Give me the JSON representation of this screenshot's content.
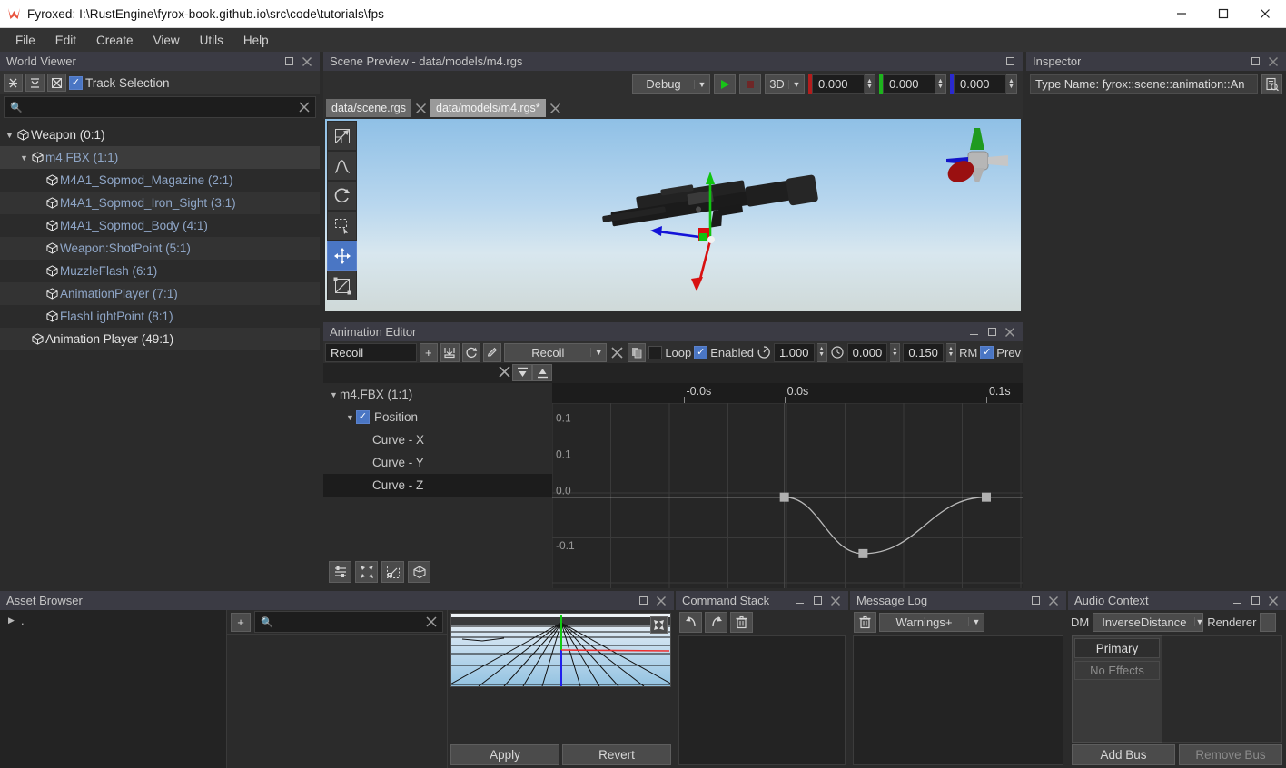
{
  "window": {
    "title": "Fyroxed: I:\\RustEngine\\fyrox-book.github.io\\src\\code\\tutorials\\fps",
    "minimize": "minimize-icon",
    "maximize": "maximize-icon",
    "close": "close-icon"
  },
  "menubar": {
    "items": [
      "File",
      "Edit",
      "Create",
      "View",
      "Utils",
      "Help"
    ]
  },
  "world_viewer": {
    "title": "World Viewer",
    "toolbar": {
      "collapse_all": "collapse-all-icon",
      "expand_all": "expand-all-icon",
      "locate_selection": "locate-selection-icon",
      "track_selection_label": "Track Selection",
      "track_selection_checked": true
    },
    "search_placeholder": "",
    "search_value": "",
    "tree": [
      {
        "label": "Weapon (0:1)",
        "indent": 0,
        "arrow": "down",
        "color": "white"
      },
      {
        "label": "m4.FBX (1:1)",
        "indent": 1,
        "arrow": "down",
        "color": "blue"
      },
      {
        "label": "M4A1_Sopmod_Magazine (2:1)",
        "indent": 2,
        "arrow": "none",
        "color": "blue"
      },
      {
        "label": "M4A1_Sopmod_Iron_Sight (3:1)",
        "indent": 2,
        "arrow": "none",
        "color": "blue"
      },
      {
        "label": "M4A1_Sopmod_Body (4:1)",
        "indent": 2,
        "arrow": "none",
        "color": "blue"
      },
      {
        "label": "Weapon:ShotPoint (5:1)",
        "indent": 2,
        "arrow": "none",
        "color": "blue"
      },
      {
        "label": "MuzzleFlash (6:1)",
        "indent": 2,
        "arrow": "none",
        "color": "blue"
      },
      {
        "label": "AnimationPlayer (7:1)",
        "indent": 2,
        "arrow": "none",
        "color": "blue"
      },
      {
        "label": "FlashLightPoint (8:1)",
        "indent": 2,
        "arrow": "none",
        "color": "blue"
      },
      {
        "label": "Animation Player (49:1)",
        "indent": 1,
        "arrow": "none",
        "color": "white"
      }
    ]
  },
  "scene_preview": {
    "title": "Scene Preview - data/models/m4.rgs",
    "toolbar": {
      "mode": "Debug",
      "play": "play-icon",
      "stop": "stop-icon",
      "projection": "3D",
      "x": "0.000",
      "y": "0.000",
      "z": "0.000",
      "x_color": "#b41d1d",
      "y_color": "#1db41d",
      "z_color": "#2a2ad0"
    },
    "tabs": [
      {
        "label": "data/scene.rgs",
        "active": false
      },
      {
        "label": "data/models/m4.rgs*",
        "active": true
      }
    ],
    "viewport_tools": [
      {
        "name": "scale-tool-icon",
        "active": false
      },
      {
        "name": "terrain-tool-icon",
        "active": false
      },
      {
        "name": "rotate-tool-icon",
        "active": false
      },
      {
        "name": "select-rect-tool-icon",
        "active": false
      },
      {
        "name": "move-tool-icon",
        "active": true
      },
      {
        "name": "navmesh-tool-icon",
        "active": false
      }
    ]
  },
  "animation_editor": {
    "title": "Animation Editor",
    "toolbar": {
      "name_value": "Recoil",
      "add": "+",
      "import": "import-icon",
      "reimport": "reimport-icon",
      "rename": "pencil-icon",
      "selected_animation": "Recoil",
      "remove": "remove-icon",
      "duplicate": "duplicate-icon",
      "loop_label": "Loop",
      "loop_checked": false,
      "enabled_label": "Enabled",
      "enabled_checked": true,
      "speed_icon": "speed-icon",
      "speed": "1.000",
      "time_icon": "clock-icon",
      "time_start": "0.000",
      "time_end": "0.150",
      "root_motion": "RM",
      "preview_label": "Prev",
      "preview_checked": true
    },
    "track_toolbar": {
      "remove_track": "remove-track-icon",
      "collapse": "collapse-icon",
      "expand": "expand-icon"
    },
    "tracks": [
      {
        "label": "m4.FBX (1:1)",
        "indent": 0,
        "arrow": "down",
        "checkbox": null,
        "selected": false
      },
      {
        "label": "Position",
        "indent": 1,
        "arrow": "down",
        "checkbox": true,
        "selected": false
      },
      {
        "label": "Curve - X",
        "indent": 2,
        "arrow": "none",
        "checkbox": null,
        "selected": false
      },
      {
        "label": "Curve - Y",
        "indent": 2,
        "arrow": "none",
        "checkbox": null,
        "selected": false
      },
      {
        "label": "Curve - Z",
        "indent": 2,
        "arrow": "none",
        "checkbox": null,
        "selected": true
      }
    ],
    "bottom_tools": [
      "track-filter-icon",
      "fit-icon",
      "zoom-to-fit-icon",
      "rebind-icon"
    ],
    "chart_data": {
      "type": "line",
      "title": "Curve - Z",
      "xlabel": "",
      "ylabel": "",
      "x_ticks": [
        {
          "value": -0.05,
          "label": "-0.0s"
        },
        {
          "value": 0.0,
          "label": "0.0s"
        },
        {
          "value": 0.1,
          "label": "0.1s"
        }
      ],
      "y_ticks": [
        {
          "value": 0.12,
          "label": "0.1"
        },
        {
          "value": 0.06,
          "label": "0.1"
        },
        {
          "value": 0.0,
          "label": "0.0"
        },
        {
          "value": -0.09,
          "label": "-0.1"
        }
      ],
      "xlim": [
        -0.115,
        0.118
      ],
      "ylim": [
        -0.15,
        0.155
      ],
      "grid": true,
      "series": [
        {
          "name": "Curve - Z",
          "points": [
            {
              "x": 0.0,
              "y": 0.0
            },
            {
              "x": 0.039,
              "y": -0.093
            },
            {
              "x": 0.1,
              "y": 0.0
            }
          ],
          "color": "#b9b9b9"
        }
      ]
    }
  },
  "inspector": {
    "title": "Inspector",
    "type_name": "Type Name: fyrox::scene::animation::An",
    "inspect_icon": "inspect-icon"
  },
  "asset_browser": {
    "title": "Asset Browser",
    "tree_root": ".",
    "add_button": "+",
    "search_placeholder": "",
    "search_value": "",
    "preview_expand": "expand-preview-icon",
    "apply_label": "Apply",
    "revert_label": "Revert"
  },
  "command_stack": {
    "title": "Command Stack",
    "undo": "undo-icon",
    "redo": "redo-icon",
    "clear": "trash-icon"
  },
  "message_log": {
    "title": "Message Log",
    "clear": "trash-icon",
    "filter": "Warnings+"
  },
  "audio_context": {
    "title": "Audio Context",
    "dm_label": "DM",
    "distance_model": "InverseDistance",
    "renderer_label": "Renderer",
    "bus_primary": "Primary",
    "no_effects": "No Effects",
    "add_bus": "Add Bus",
    "remove_bus": "Remove Bus"
  }
}
